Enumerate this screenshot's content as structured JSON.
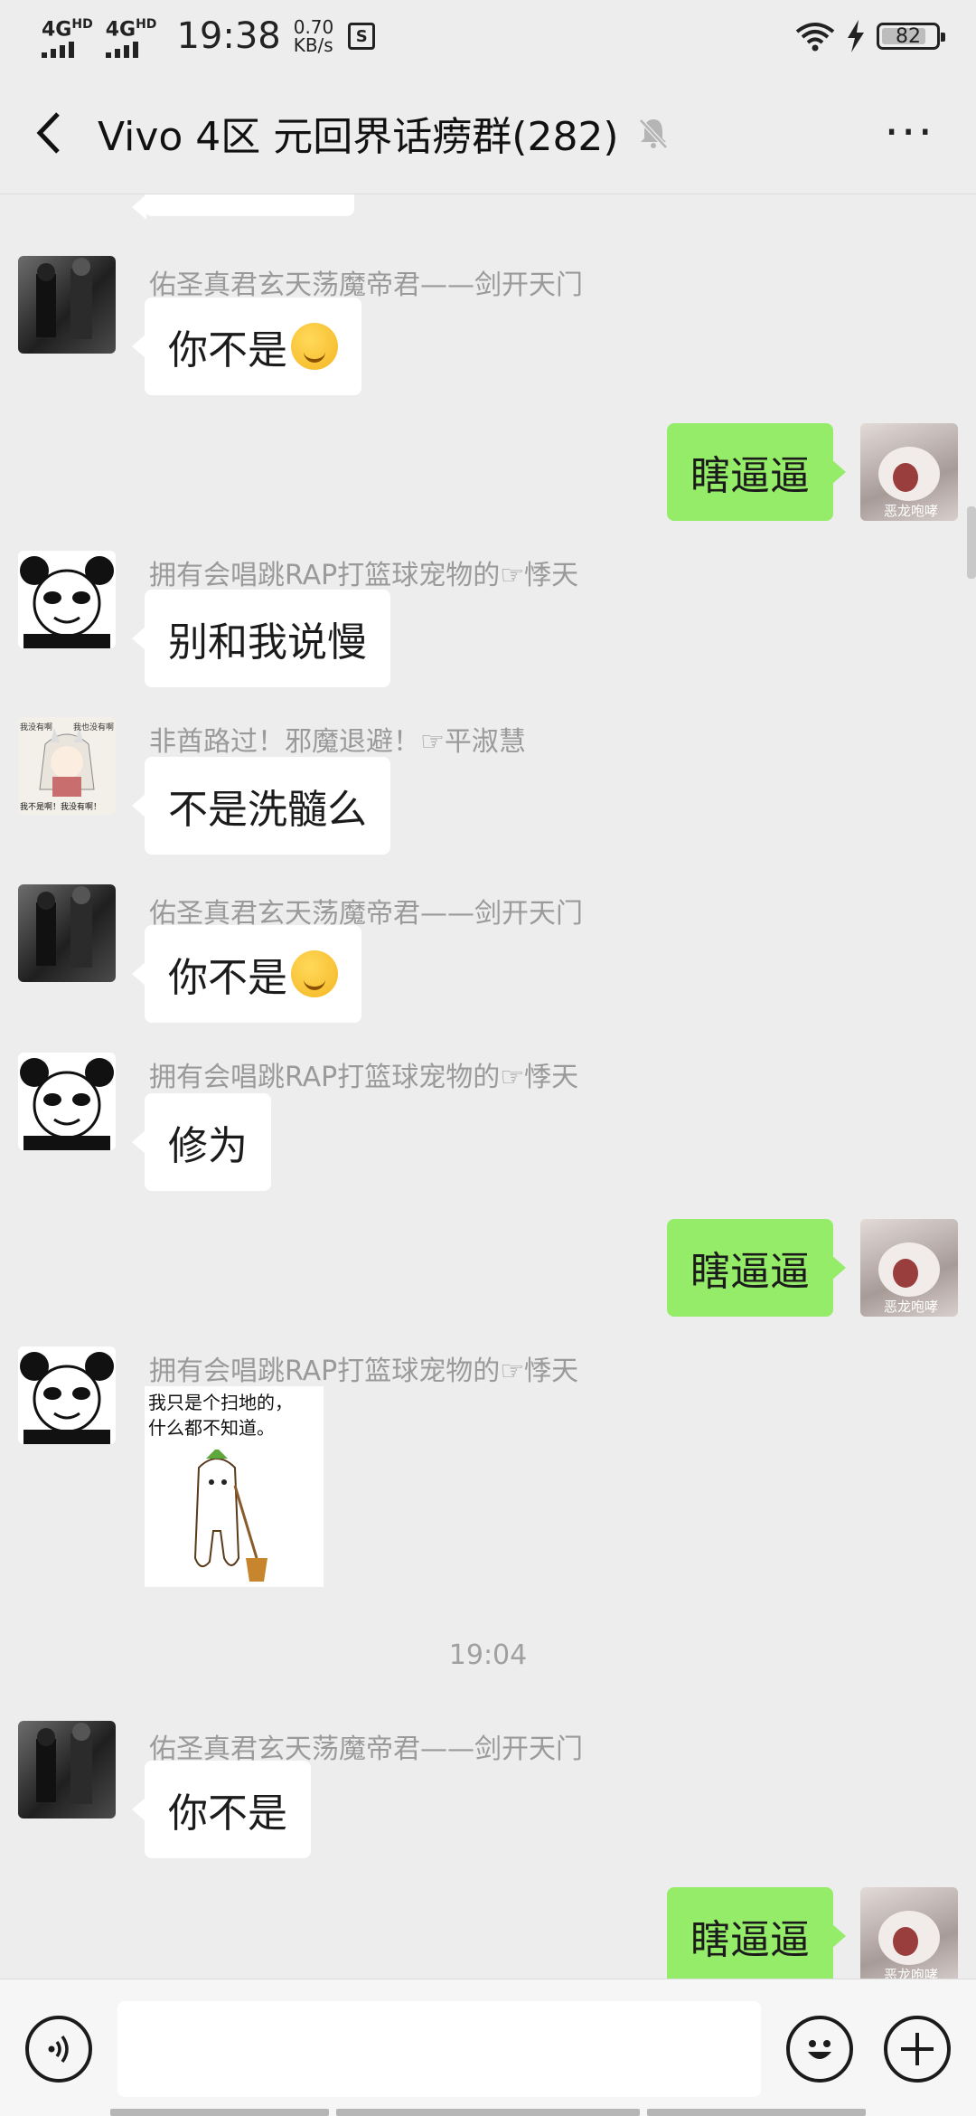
{
  "status_bar": {
    "net1": "4G",
    "net1_sup": "HD",
    "net2": "4G",
    "net2_sup": "HD",
    "time": "19:38",
    "speed_value": "0.70",
    "speed_unit": "KB/s",
    "sim_badge": "S",
    "battery": "82",
    "battery_level": 0.82
  },
  "nav": {
    "title": "Vivo 4区 元回界话痨群(282)",
    "icons": [
      "back-arrow-icon",
      "mute-bell-icon",
      "more-dots-icon"
    ],
    "more": "···"
  },
  "messages": [
    {
      "side": "left",
      "avatar": "dark-photo",
      "sender": "佑圣真君玄天荡魔帝君——剑开天门",
      "text": "你不是",
      "emoji": "smirk-emoji"
    },
    {
      "side": "right",
      "avatar": "self",
      "text": "瞎逼逼"
    },
    {
      "side": "left",
      "avatar": "panda",
      "sender": "拥有会唱跳RAP打篮球宠物的☞悸天",
      "text": "别和我说慢"
    },
    {
      "side": "left",
      "avatar": "anime-girl",
      "sender": "非酋路过！邪魔退避！☞平淑慧",
      "text": "不是洗髓么"
    },
    {
      "side": "left",
      "avatar": "dark-photo",
      "sender": "佑圣真君玄天荡魔帝君——剑开天门",
      "text": "你不是",
      "emoji": "thinking-emoji"
    },
    {
      "side": "left",
      "avatar": "panda",
      "sender": "拥有会唱跳RAP打篮球宠物的☞悸天",
      "text": "修为"
    },
    {
      "side": "right",
      "avatar": "self",
      "text": "瞎逼逼"
    },
    {
      "side": "left",
      "avatar": "panda",
      "sender": "拥有会唱跳RAP打篮球宠物的☞悸天",
      "sticker_caption": "我只是个扫地的，\n什么都不知道。"
    },
    {
      "divider": "19:04"
    },
    {
      "side": "left",
      "avatar": "dark-photo",
      "sender": "佑圣真君玄天荡魔帝君——剑开天门",
      "text": "你不是"
    },
    {
      "side": "right",
      "avatar": "self",
      "text": "瞎逼逼"
    }
  ],
  "avatar_labels": {
    "self": "恶龙咆哮",
    "anime_top_left": "我没有啊",
    "anime_top_right": "我也没有啊",
    "anime_bottom": "我不是啊！我没有啊！"
  },
  "input_bar": {
    "icons": [
      "voice-icon",
      "emoji-icon",
      "add-icon"
    ],
    "placeholder": ""
  },
  "colors": {
    "background": "#ededed",
    "self_bubble": "#95ec69",
    "other_bubble": "#ffffff",
    "nickname": "#9a9a9a"
  }
}
